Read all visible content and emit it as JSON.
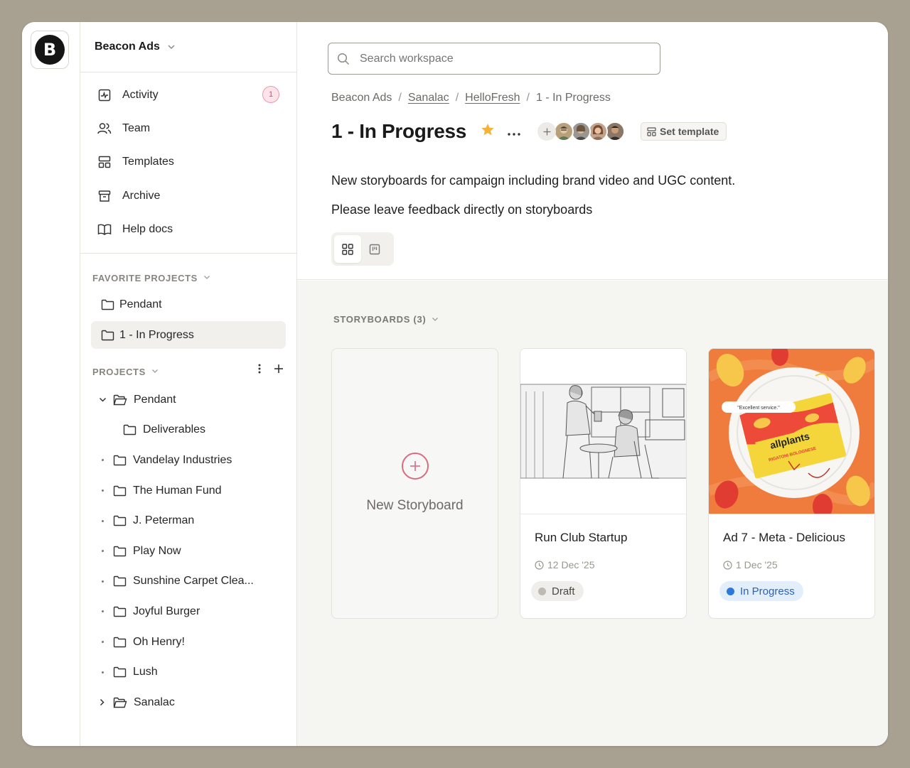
{
  "workspace": {
    "name": "Beacon Ads",
    "logo_letter": "B"
  },
  "nav": [
    {
      "label": "Activity",
      "icon": "activity-icon",
      "badge": "1"
    },
    {
      "label": "Team",
      "icon": "team-icon"
    },
    {
      "label": "Templates",
      "icon": "templates-icon"
    },
    {
      "label": "Archive",
      "icon": "archive-icon"
    },
    {
      "label": "Help docs",
      "icon": "book-icon"
    }
  ],
  "favorites": {
    "heading": "FAVORITE PROJECTS",
    "items": [
      {
        "label": "Pendant"
      },
      {
        "label": "1 - In Progress",
        "active": true
      }
    ]
  },
  "projects": {
    "heading": "PROJECTS",
    "items": [
      {
        "label": "Pendant",
        "expanded": true
      },
      {
        "label": "Deliverables",
        "child": true
      },
      {
        "label": "Vandelay Industries"
      },
      {
        "label": "The Human Fund"
      },
      {
        "label": "J. Peterman"
      },
      {
        "label": "Play Now"
      },
      {
        "label": "Sunshine Carpet Clea..."
      },
      {
        "label": "Joyful Burger"
      },
      {
        "label": "Oh Henry!"
      },
      {
        "label": "Lush"
      },
      {
        "label": "Sanalac",
        "collapsed": true
      }
    ]
  },
  "search": {
    "placeholder": "Search workspace"
  },
  "breadcrumb": [
    {
      "label": "Beacon Ads",
      "link": false
    },
    {
      "label": "Sanalac",
      "link": true
    },
    {
      "label": "HelloFresh",
      "link": true
    },
    {
      "label": "1 - In Progress",
      "link": false
    }
  ],
  "page": {
    "title": "1 - In Progress",
    "set_template_label": "Set template",
    "description": [
      "New storyboards for campaign including brand video and UGC content.",
      "Please leave feedback directly on storyboards"
    ]
  },
  "storyboards": {
    "heading": "STORYBOARDS (3)",
    "new_label": "New Storyboard",
    "cards": [
      {
        "title": "Run Club Startup",
        "date": "12 Dec '25",
        "status": "Draft"
      },
      {
        "title": "Ad 7 - Meta - Delicious",
        "date": "1 Dec '25",
        "status": "In Progress",
        "thumb_text_1": "allplants",
        "thumb_text_2": "RIGATONI BOLOGNESE",
        "thumb_quote": "\"Excellent service.\""
      }
    ]
  },
  "colors": {
    "accent": "#d86c82",
    "star": "#f4b43c",
    "in_progress": "#2f78d8",
    "draft": "#bdbab4",
    "background": "#a8a192"
  }
}
